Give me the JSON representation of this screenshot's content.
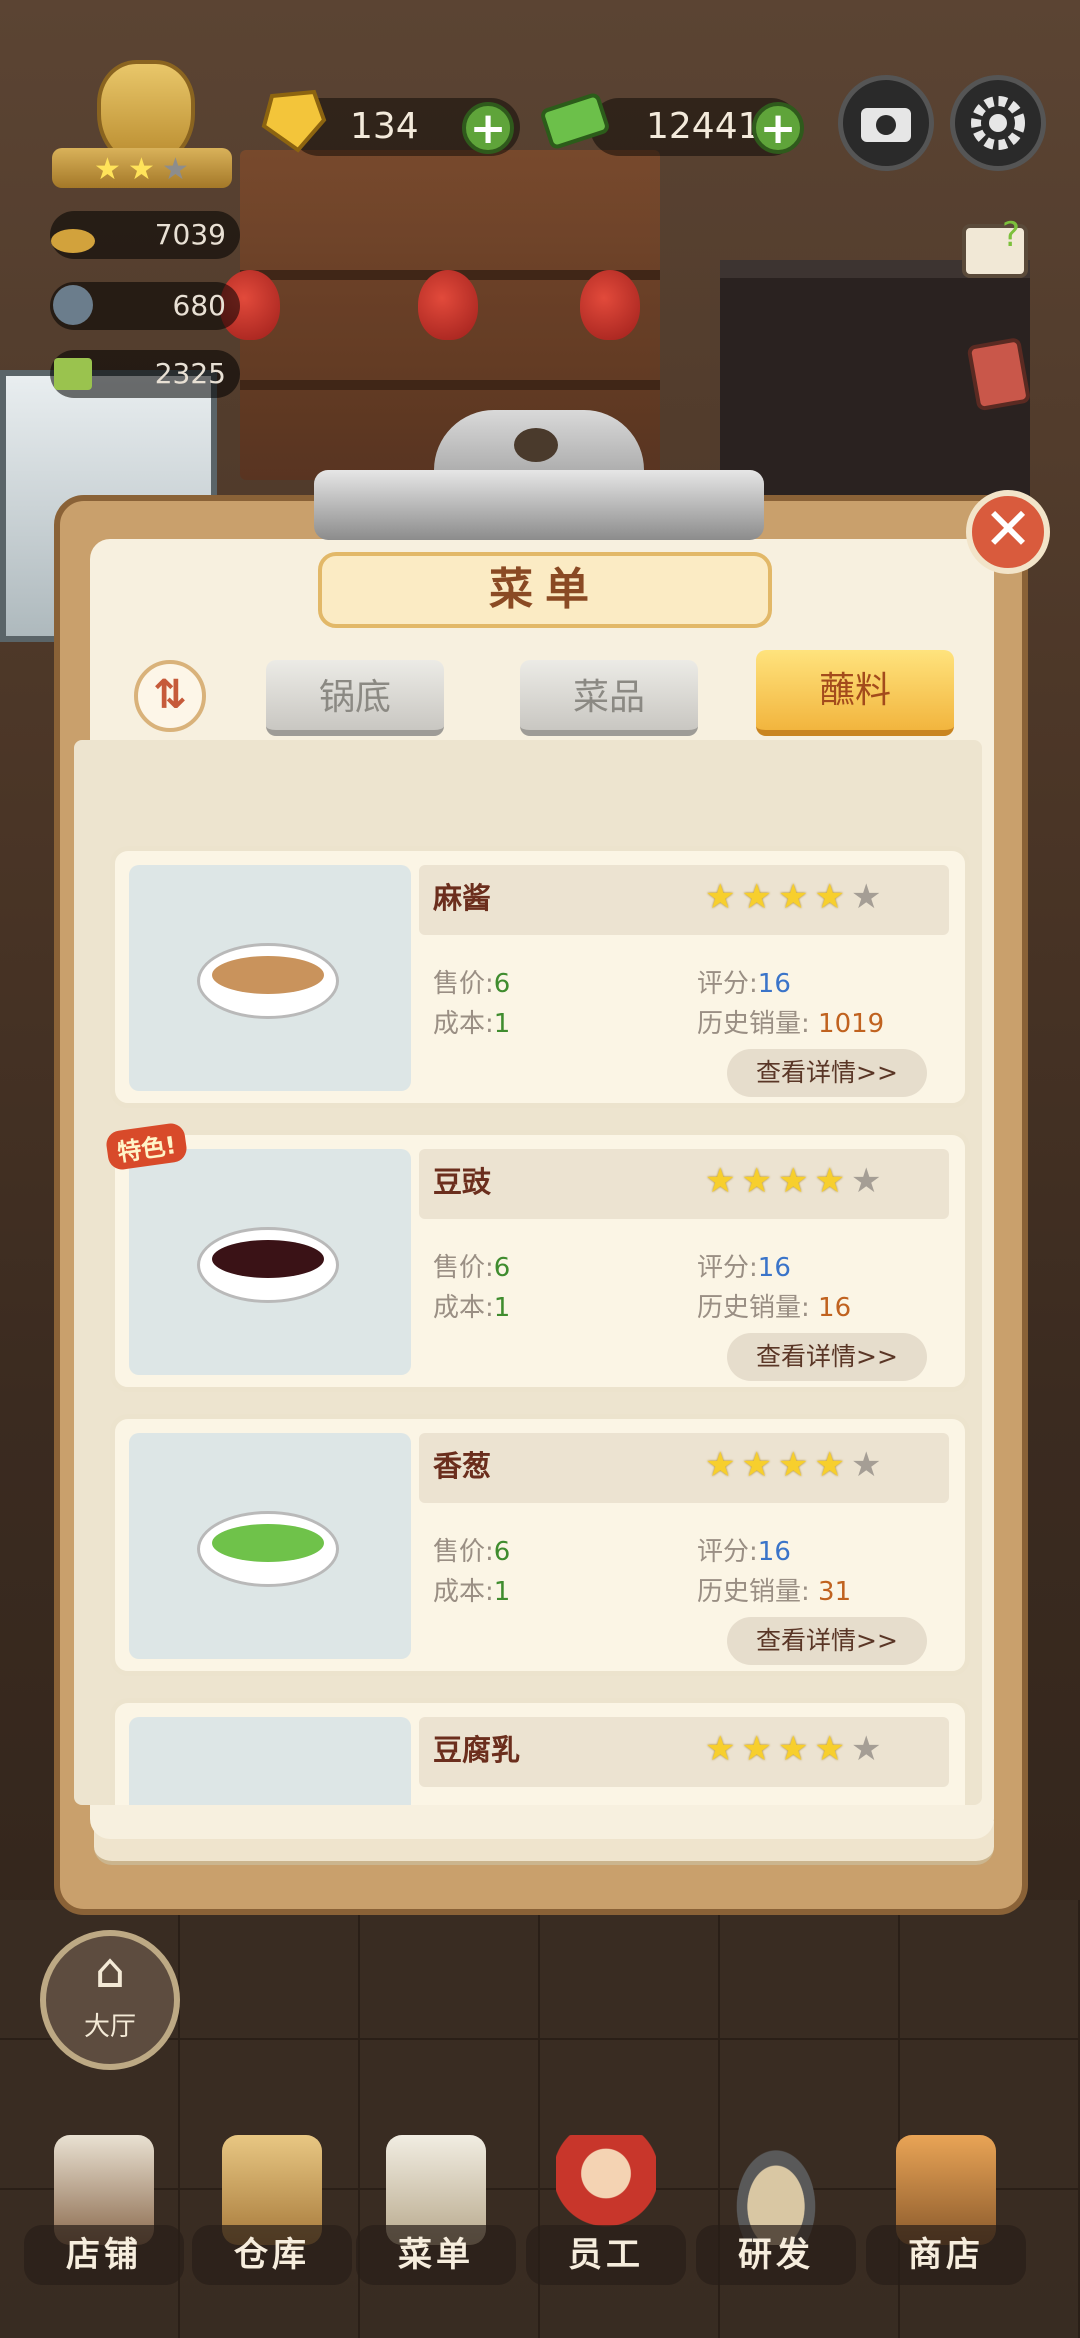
{
  "hud": {
    "gems": "134",
    "cash": "12441",
    "stats": [
      "7039",
      "680",
      "2325"
    ]
  },
  "menu": {
    "title": "菜单",
    "sort_icon": "sort-updown-icon",
    "tabs": [
      "锅底",
      "菜品",
      "蘸料"
    ],
    "active_tab": 2
  },
  "items": [
    {
      "name": "麻酱",
      "price_label": "售价",
      "price": "6",
      "cost_label": "成本",
      "cost": "1",
      "score_label": "评分",
      "score": "16",
      "sales_label": "历史销量",
      "sales": "1019",
      "stars": 4,
      "detail": "查看详情>>",
      "color": "#c9935c",
      "special": ""
    },
    {
      "name": "豆豉",
      "price_label": "售价",
      "price": "6",
      "cost_label": "成本",
      "cost": "1",
      "score_label": "评分",
      "score": "16",
      "sales_label": "历史销量",
      "sales": "16",
      "stars": 4,
      "detail": "查看详情>>",
      "color": "#3a1216",
      "special": "特色!"
    },
    {
      "name": "香葱",
      "price_label": "售价",
      "price": "6",
      "cost_label": "成本",
      "cost": "1",
      "score_label": "评分",
      "score": "16",
      "sales_label": "历史销量",
      "sales": "31",
      "stars": 4,
      "detail": "查看详情>>",
      "color": "#6fc24a",
      "special": ""
    },
    {
      "name": "豆腐乳",
      "stars": 4,
      "color": "#e8c98a"
    }
  ],
  "hall_button": "大厅",
  "nav": [
    "店铺",
    "仓库",
    "菜单",
    "员工",
    "研发",
    "商店"
  ],
  "colors": {
    "accent": "#f2b53e",
    "close": "#d95b3d",
    "green": "#5fa43a"
  }
}
